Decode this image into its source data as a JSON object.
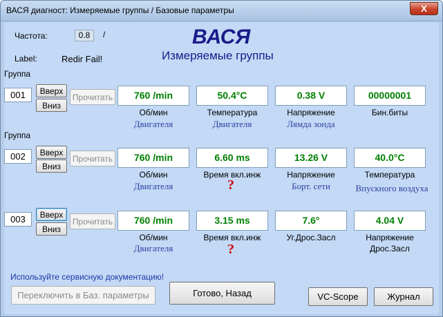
{
  "window": {
    "title": "ВАСЯ диагност: Измеряемые группы / Базовые параметры",
    "close_glyph": "X"
  },
  "header": {
    "freq_label": "Частота:",
    "freq_value": "0.8",
    "freq_slash": "/",
    "label_label": "Label:",
    "label_value": "Redir Fail!",
    "app_title": "ВАСЯ",
    "subtitle": "Измеряемые группы"
  },
  "buttons": {
    "up": "Вверх",
    "down": "Вниз",
    "read": "Прочитать"
  },
  "groups": [
    {
      "label": "Группа",
      "number": "001",
      "cells": [
        {
          "value": "760 /min",
          "cap1": "Об/мин",
          "cap2": "Двигателя"
        },
        {
          "value": "50.4°C",
          "cap1": "Температура",
          "cap2": "Двигателя"
        },
        {
          "value": "0.38 V",
          "cap1": "Напряжение",
          "cap2": "Лямда зонда"
        },
        {
          "value": "00000001",
          "cap1": "Бин.биты",
          "cap2": ""
        }
      ]
    },
    {
      "label": "Группа",
      "number": "002",
      "cells": [
        {
          "value": "760 /min",
          "cap1": "Об/мин",
          "cap2": "Двигателя"
        },
        {
          "value": "6.60 ms",
          "cap1": "Время вкл.инж",
          "cap2": "?"
        },
        {
          "value": "13.26 V",
          "cap1": "Напряжение",
          "cap2": "Борт. сети"
        },
        {
          "value": "40.0°C",
          "cap1": "Температура",
          "cap2": "Впускного воздуха"
        }
      ]
    },
    {
      "label": "",
      "number": "003",
      "cells": [
        {
          "value": "760 /min",
          "cap1": "Об/мин",
          "cap2": "Двигателя"
        },
        {
          "value": "3.15 ms",
          "cap1": "Время вкл.инж",
          "cap2": "?"
        },
        {
          "value": "7.6°",
          "cap1": "Уг.Дрос.Засл",
          "cap2": ""
        },
        {
          "value": "4.04 V",
          "cap1": "Напряжение",
          "cap2": "Дрос.Засл"
        }
      ]
    }
  ],
  "footer": {
    "help_text": "Используйте сервисную документацию!",
    "switch_button": "Переключить в Баз. параметры",
    "done_button": "Готово, Назад",
    "vcscope_button": "VC-Scope",
    "journal_button": "Журнал"
  }
}
